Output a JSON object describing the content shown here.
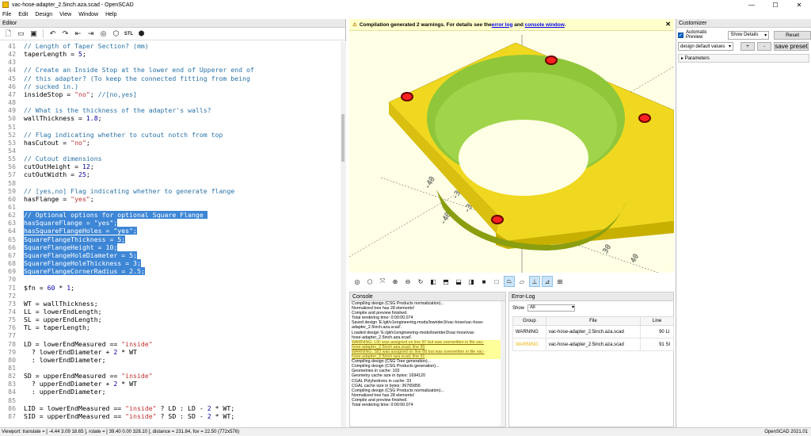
{
  "window": {
    "title": "vac-hose-adapter_2.5inch.aza.scad - OpenSCAD",
    "minimize": "—",
    "maximize": "☐",
    "close": "✕"
  },
  "menu": [
    "File",
    "Edit",
    "Design",
    "View",
    "Window",
    "Help"
  ],
  "editor": {
    "header": "Editor",
    "toolbar_icons": [
      "new-file-icon",
      "open-file-icon",
      "save-icon",
      "undo-icon",
      "redo-icon",
      "unindent-icon",
      "indent-icon",
      "preview-icon",
      "render-icon",
      "export-stl-icon",
      "send-to-print-icon"
    ],
    "lines": [
      {
        "n": "41",
        "parts": [
          [
            "c",
            "// Length of Taper Section? (mm)"
          ]
        ]
      },
      {
        "n": "42",
        "parts": [
          [
            "t",
            "taperLength = "
          ],
          [
            "k",
            "5"
          ],
          [
            "t",
            ";"
          ]
        ]
      },
      {
        "n": "43",
        "parts": []
      },
      {
        "n": "44",
        "parts": [
          [
            "c",
            "// Create an Inside Stop at the lower end of Upperer end of"
          ]
        ]
      },
      {
        "n": "45",
        "parts": [
          [
            "c",
            "// this adapter? (To keep the connected fitting from being"
          ]
        ]
      },
      {
        "n": "46",
        "parts": [
          [
            "c",
            "// sucked in.)"
          ]
        ]
      },
      {
        "n": "47",
        "parts": [
          [
            "t",
            "insideStop = "
          ],
          [
            "s",
            "\"no\""
          ],
          [
            "t",
            "; "
          ],
          [
            "c",
            "//[no,yes]"
          ]
        ]
      },
      {
        "n": "48",
        "parts": []
      },
      {
        "n": "49",
        "parts": [
          [
            "c",
            "// What is the thickness of the adapter's walls?"
          ]
        ]
      },
      {
        "n": "50",
        "parts": [
          [
            "t",
            "wallThickness = "
          ],
          [
            "k",
            "1.8"
          ],
          [
            "t",
            ";"
          ]
        ]
      },
      {
        "n": "51",
        "parts": []
      },
      {
        "n": "52",
        "parts": [
          [
            "c",
            "// Flag indicating whether to cutout notch from top"
          ]
        ]
      },
      {
        "n": "53",
        "parts": [
          [
            "t",
            "hasCutout = "
          ],
          [
            "s",
            "\"no\""
          ],
          [
            "t",
            ";"
          ]
        ]
      },
      {
        "n": "54",
        "parts": []
      },
      {
        "n": "55",
        "parts": [
          [
            "c",
            "// Cutout dimensions"
          ]
        ]
      },
      {
        "n": "56",
        "parts": [
          [
            "t",
            "cutOutHeight = "
          ],
          [
            "k",
            "12"
          ],
          [
            "t",
            ";"
          ]
        ]
      },
      {
        "n": "57",
        "parts": [
          [
            "t",
            "cutOutWidth = "
          ],
          [
            "k",
            "25"
          ],
          [
            "t",
            ";"
          ]
        ]
      },
      {
        "n": "58",
        "parts": []
      },
      {
        "n": "59",
        "parts": [
          [
            "c",
            "// [yes,no] Flag indicating whether to generate flange"
          ]
        ]
      },
      {
        "n": "60",
        "parts": [
          [
            "t",
            "hasFlange = "
          ],
          [
            "s",
            "\"yes\""
          ],
          [
            "t",
            ";"
          ]
        ]
      },
      {
        "n": "61",
        "parts": []
      },
      {
        "n": "62",
        "sel": true,
        "parts": [
          [
            "t",
            "// Optional options for optional Square Flange "
          ]
        ]
      },
      {
        "n": "63",
        "sel": true,
        "parts": [
          [
            "t",
            "hasSquareFlange = \"yes\";"
          ]
        ]
      },
      {
        "n": "64",
        "sel": true,
        "parts": [
          [
            "t",
            "hasSquareFlangeHoles = \"yes\";"
          ]
        ]
      },
      {
        "n": "65",
        "sel": true,
        "parts": [
          [
            "t",
            "SquareFlangeThickness = 5;"
          ]
        ]
      },
      {
        "n": "66",
        "sel": true,
        "parts": [
          [
            "t",
            "SquareFlangeHeight = 10;"
          ]
        ]
      },
      {
        "n": "67",
        "sel": true,
        "parts": [
          [
            "t",
            "SquareFlangeHoleDiameter = 5;"
          ]
        ]
      },
      {
        "n": "68",
        "sel": true,
        "parts": [
          [
            "t",
            "SquareFlangeHoleThickness = 3;"
          ]
        ]
      },
      {
        "n": "69",
        "sel": true,
        "parts": [
          [
            "t",
            "SquareFlangeCornerRadius = 2.5;"
          ]
        ]
      },
      {
        "n": "70",
        "parts": []
      },
      {
        "n": "71",
        "parts": [
          [
            "t",
            "$fn = "
          ],
          [
            "k",
            "60"
          ],
          [
            "t",
            " * "
          ],
          [
            "k",
            "1"
          ],
          [
            "t",
            ";"
          ]
        ]
      },
      {
        "n": "72",
        "parts": []
      },
      {
        "n": "73",
        "parts": [
          [
            "t",
            "WT = wallThickness;"
          ]
        ]
      },
      {
        "n": "74",
        "parts": [
          [
            "t",
            "LL = lowerEndLength;"
          ]
        ]
      },
      {
        "n": "75",
        "parts": [
          [
            "t",
            "SL = upperEndLength;"
          ]
        ]
      },
      {
        "n": "76",
        "parts": [
          [
            "t",
            "TL = taperLength;"
          ]
        ]
      },
      {
        "n": "77",
        "parts": []
      },
      {
        "n": "78",
        "parts": [
          [
            "t",
            "LD = lowerEndMeasured == "
          ],
          [
            "s",
            "\"inside\""
          ]
        ]
      },
      {
        "n": "79",
        "parts": [
          [
            "t",
            "  ? lowerEndDiameter + "
          ],
          [
            "k",
            "2"
          ],
          [
            "t",
            " * WT"
          ]
        ]
      },
      {
        "n": "80",
        "parts": [
          [
            "t",
            "  : lowerEndDiameter;"
          ]
        ]
      },
      {
        "n": "81",
        "parts": []
      },
      {
        "n": "82",
        "parts": [
          [
            "t",
            "SD = upperEndMeasured == "
          ],
          [
            "s",
            "\"inside\""
          ]
        ]
      },
      {
        "n": "83",
        "parts": [
          [
            "t",
            "  ? upperEndDiameter + "
          ],
          [
            "k",
            "2"
          ],
          [
            "t",
            " * WT"
          ]
        ]
      },
      {
        "n": "84",
        "parts": [
          [
            "t",
            "  : upperEndDiameter;"
          ]
        ]
      },
      {
        "n": "85",
        "parts": []
      },
      {
        "n": "86",
        "parts": [
          [
            "t",
            "LID = lowerEndMeasured == "
          ],
          [
            "s",
            "\"inside\""
          ],
          [
            "t",
            " ? LD : LD - "
          ],
          [
            "k",
            "2"
          ],
          [
            "t",
            " * WT;"
          ]
        ]
      },
      {
        "n": "87",
        "parts": [
          [
            "t",
            "SID = upperEndMeasured == "
          ],
          [
            "s",
            "\"inside\""
          ],
          [
            "t",
            " ? SD : SD - "
          ],
          [
            "k",
            "2"
          ],
          [
            "t",
            " * WT;"
          ]
        ]
      }
    ]
  },
  "viewport": {
    "warning_prefix": "Compilation generated 2 warnings. For details see the ",
    "warning_link1": "error log",
    "warning_mid": " and ",
    "warning_link2": "console window",
    "warning_end": ".",
    "axis_labels": [
      "-40",
      "-30",
      "-20",
      "-10",
      "10",
      "20",
      "30",
      "40",
      "-40",
      "-30",
      "-20",
      "-10",
      "10",
      "20",
      "30",
      "40"
    ],
    "toolbar_icons": [
      "preview-icon",
      "render-icon",
      "zoom-all-icon",
      "zoom-in-icon",
      "zoom-out-icon",
      "reset-view-icon",
      "view-right-icon",
      "view-top-icon",
      "view-bottom-icon",
      "view-left-icon",
      "view-front-icon",
      "view-back-icon",
      "perspective-icon",
      "orthogonal-icon",
      "show-axes-icon",
      "show-scale-icon",
      "show-edges-icon"
    ]
  },
  "console": {
    "header": "Console",
    "lines": [
      {
        "w": false,
        "t": "Compiling design (CSG Products normalization)..."
      },
      {
        "w": false,
        "t": "Normalized tree has 28 elements!"
      },
      {
        "w": false,
        "t": "Compile and preview finished."
      },
      {
        "w": false,
        "t": "Total rendering time: 0:00:00.074"
      },
      {
        "w": false,
        "t": "Saved design 'E:/git/v1engineering-mods/lowrider3/vac-hose/vac-hose-"
      },
      {
        "w": false,
        "t": "adapter_2.5inch.aza.scad'."
      },
      {
        "w": false,
        "t": "Loaded design 'E:/git/v1engineering-mods/lowrider3/vac-hose/vac-"
      },
      {
        "w": false,
        "t": "hose-adapter_2.5inch.aza.scad'."
      },
      {
        "w": true,
        "t": "WARNING: LID was assigned on line 87 but was overwritten in file vac-"
      },
      {
        "w": true,
        "t": "hose-adapter_2.5inch.aza.scad, line 90"
      },
      {
        "w": true,
        "t": "WARNING: SID was assigned on line 88 but was overwritten in file vac-"
      },
      {
        "w": true,
        "t": "hose-adapter_2.5inch.aza.scad, line 91"
      },
      {
        "w": false,
        "t": "Compiling design (CSG Tree generation)..."
      },
      {
        "w": false,
        "t": "Compiling design (CSG Products generation)..."
      },
      {
        "w": false,
        "t": "Geometries in cache: 103"
      },
      {
        "w": false,
        "t": "Geometry cache size in bytes: 1694120"
      },
      {
        "w": false,
        "t": "CGAL Polyhedrons in cache: 33"
      },
      {
        "w": false,
        "t": "CGAL cache size in bytes: 36765856"
      },
      {
        "w": false,
        "t": "Compiling design (CSG Products normalization)..."
      },
      {
        "w": false,
        "t": "Normalized tree has 28 elements!"
      },
      {
        "w": false,
        "t": "Compile and preview finished."
      },
      {
        "w": false,
        "t": "Total rendering time: 0:00:00.074"
      }
    ]
  },
  "errorlog": {
    "header": "Error-Log",
    "show_label": "Show",
    "show_value": "All",
    "columns": [
      "Group",
      "File",
      "Line"
    ],
    "rows": [
      {
        "group": "WARNING",
        "file": "vac-hose-adapter_2.5inch.aza.scad",
        "line": "90",
        "extra": "LI"
      },
      {
        "group": "WARNING",
        "file": "vac-hose-adapter_2.5inch.aza.scad",
        "line": "91",
        "extra": "SI"
      }
    ]
  },
  "customizer": {
    "header": "Customizer",
    "auto_preview": "Automatic Preview",
    "show_details": "Show Details",
    "reset": "Reset",
    "preset": "design default values",
    "plus": "+",
    "minus": "-",
    "save_preset": "save preset",
    "parameters": "Parameters"
  },
  "status": {
    "viewport": "Viewport: translate = [ -4.44 3.09 18.65 ], rotate = [ 39.40 0.00 328.10 ], distance = 231.84, fov = 22.50 (772x576)",
    "version": "OpenSCAD 2021.01"
  },
  "colors": {
    "model": "#f0d820",
    "model_inner": "#90cc40",
    "selection": "#3d86d6",
    "viewport_bg": "#ffffe5"
  }
}
